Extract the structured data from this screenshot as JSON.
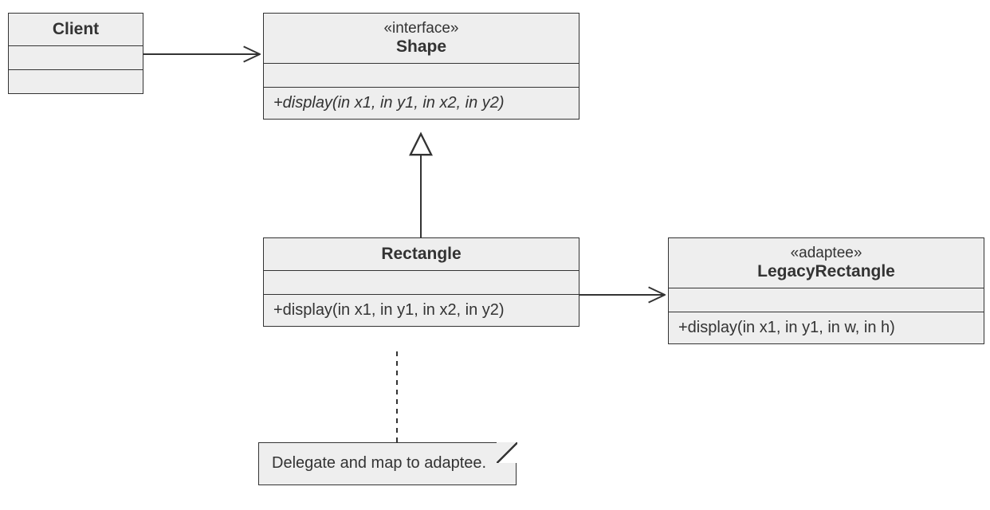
{
  "diagram": {
    "client": {
      "name": "Client"
    },
    "shape": {
      "stereotype": "«interface»",
      "name": "Shape",
      "operation": "+display(in x1, in y1, in x2, in y2)"
    },
    "rectangle": {
      "name": "Rectangle",
      "operation": "+display(in x1, in y1, in x2, in y2)"
    },
    "legacy": {
      "stereotype": "«adaptee»",
      "name": "LegacyRectangle",
      "operation": "+display(in x1, in y1, in w, in h)"
    },
    "note": "Delegate and map to adaptee."
  }
}
